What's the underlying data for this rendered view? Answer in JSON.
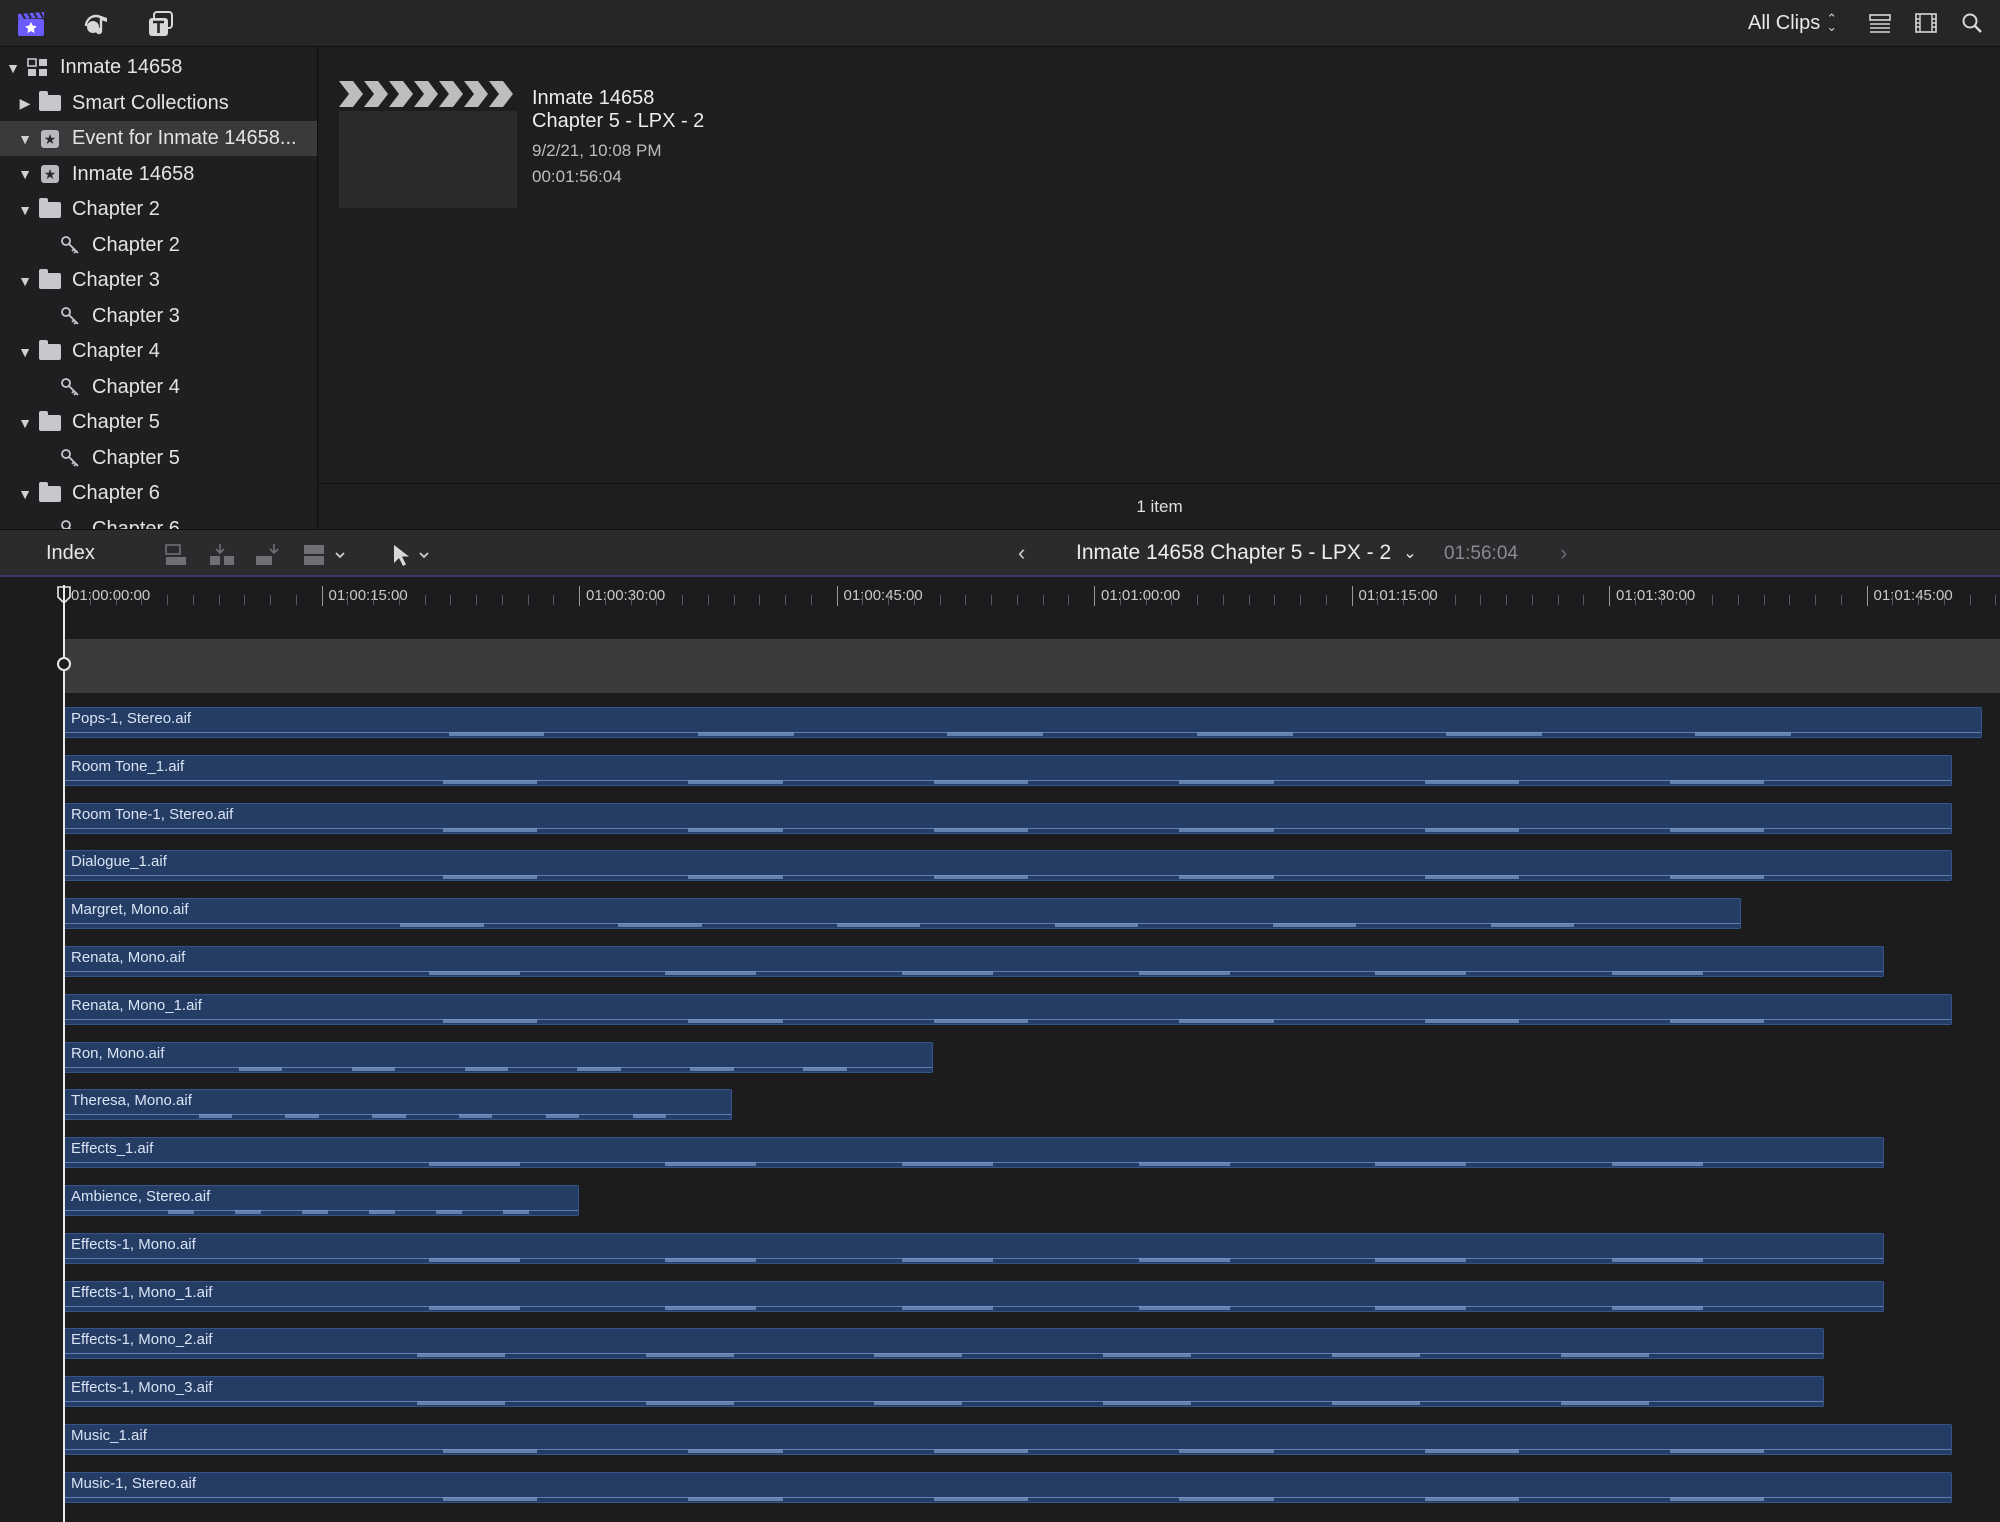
{
  "toolbar": {
    "left_icons": [
      "libraries-icon",
      "photos-audio-icon",
      "titles-generators-icon"
    ],
    "filter_label": "All Clips",
    "right_icons": [
      "list-view-icon",
      "filmstrip-view-icon",
      "search-icon"
    ]
  },
  "sidebar": {
    "items": [
      {
        "label": "Inmate 14658",
        "disclosure": "open",
        "icon": "library-icon",
        "indent": 0
      },
      {
        "label": "Smart Collections",
        "disclosure": "closed",
        "icon": "folder-icon",
        "indent": 1
      },
      {
        "label": "Event for Inmate 14658...",
        "disclosure": "open",
        "icon": "event-star-icon",
        "indent": 1,
        "selected": true
      },
      {
        "label": "Inmate 14658",
        "disclosure": "open",
        "icon": "event-star-icon",
        "indent": 1
      },
      {
        "label": "Chapter 2",
        "disclosure": "open",
        "icon": "folder-icon",
        "indent": 2
      },
      {
        "label": "Chapter 2",
        "disclosure": "",
        "icon": "keyword-icon",
        "indent": 3
      },
      {
        "label": "Chapter 3",
        "disclosure": "open",
        "icon": "folder-icon",
        "indent": 2
      },
      {
        "label": "Chapter 3",
        "disclosure": "",
        "icon": "keyword-icon",
        "indent": 3
      },
      {
        "label": "Chapter 4",
        "disclosure": "open",
        "icon": "folder-icon",
        "indent": 2
      },
      {
        "label": "Chapter 4",
        "disclosure": "",
        "icon": "keyword-icon",
        "indent": 3
      },
      {
        "label": "Chapter 5",
        "disclosure": "open",
        "icon": "folder-icon",
        "indent": 2
      },
      {
        "label": "Chapter 5",
        "disclosure": "",
        "icon": "keyword-icon",
        "indent": 3
      },
      {
        "label": "Chapter 6",
        "disclosure": "open",
        "icon": "folder-icon",
        "indent": 2
      },
      {
        "label": "Chapter 6",
        "disclosure": "",
        "icon": "keyword-icon",
        "indent": 3
      }
    ]
  },
  "browser": {
    "clip": {
      "title_line1": "Inmate 14658",
      "title_line2": "Chapter 5 - LPX - 2",
      "date": "9/2/21, 10:08 PM",
      "duration": "00:01:56:04"
    },
    "footer": "1 item"
  },
  "timeline_toolbar": {
    "index_label": "Index",
    "project_name": "Inmate 14658 Chapter 5 - LPX - 2",
    "project_duration": "01:56:04"
  },
  "ruler": {
    "labels": [
      "01:00:00:00",
      "01:00:15:00",
      "01:00:30:00",
      "01:00:45:00",
      "01:01:00:00",
      "01:01:15:00",
      "01:01:30:00",
      "01:01:45:00"
    ]
  },
  "clips": [
    {
      "name": "Pops-1, Stereo.aif",
      "end_seconds": 112.0
    },
    {
      "name": "Room Tone_1.aif",
      "end_seconds": 110.0
    },
    {
      "name": "Room Tone-1, Stereo.aif",
      "end_seconds": 110.0
    },
    {
      "name": "Dialogue_1.aif",
      "end_seconds": 110.0
    },
    {
      "name": "Margret, Mono.aif",
      "end_seconds": 97.7
    },
    {
      "name": "Renata, Mono.aif",
      "end_seconds": 106.0
    },
    {
      "name": "Renata, Mono_1.aif",
      "end_seconds": 110.0
    },
    {
      "name": "Ron, Mono.aif",
      "end_seconds": 50.6
    },
    {
      "name": "Theresa, Mono.aif",
      "end_seconds": 38.9
    },
    {
      "name": "Effects_1.aif",
      "end_seconds": 106.0
    },
    {
      "name": "Ambience, Stereo.aif",
      "end_seconds": 30.0
    },
    {
      "name": "Effects-1, Mono.aif",
      "end_seconds": 106.0
    },
    {
      "name": "Effects-1, Mono_1.aif",
      "end_seconds": 106.0
    },
    {
      "name": "Effects-1, Mono_2.aif",
      "end_seconds": 102.5
    },
    {
      "name": "Effects-1, Mono_3.aif",
      "end_seconds": 102.5
    },
    {
      "name": "Music_1.aif",
      "end_seconds": 110.0
    },
    {
      "name": "Music-1, Stereo.aif",
      "end_seconds": 110.0
    }
  ],
  "colors": {
    "clip_fill": "#253d64",
    "clip_border": "#34558a",
    "accent_purple": "#6a5cff"
  }
}
